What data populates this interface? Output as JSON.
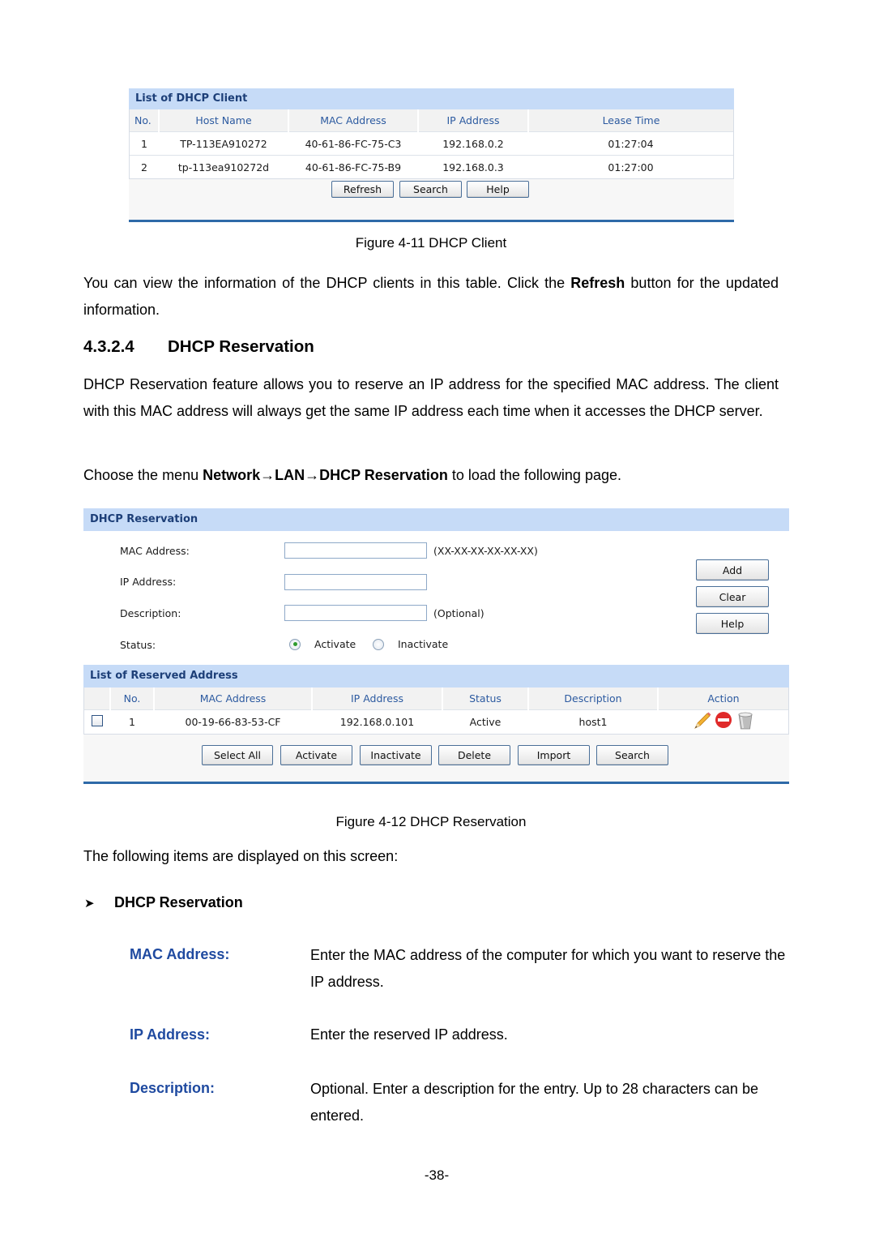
{
  "figure1": {
    "panel_title": "List of DHCP Client",
    "columns": [
      "No.",
      "Host Name",
      "MAC Address",
      "IP Address",
      "Lease Time"
    ],
    "rows": [
      [
        "1",
        "TP-113EA910272",
        "40-61-86-FC-75-C3",
        "192.168.0.2",
        "01:27:04"
      ],
      [
        "2",
        "tp-113ea910272d",
        "40-61-86-FC-75-B9",
        "192.168.0.3",
        "01:27:00"
      ]
    ],
    "buttons": {
      "refresh": "Refresh",
      "search": "Search",
      "help": "Help"
    },
    "caption": "Figure 4-11 DHCP Client"
  },
  "para1": {
    "before": "You can view the information of the DHCP clients in this table. Click the ",
    "bold": "Refresh",
    "after": " button for the updated information."
  },
  "section": {
    "number": "4.3.2.4",
    "title": "DHCP Reservation"
  },
  "para2": "DHCP Reservation feature allows you to reserve an IP address for the specified MAC address. The client with this MAC address will always get the same IP address each time when it accesses the DHCP server.",
  "para3": {
    "before": "Choose the menu ",
    "bold": "Network→LAN→DHCP Reservation",
    "after": " to load the following page."
  },
  "figure2": {
    "form_title": "DHCP Reservation",
    "form": {
      "mac_label": "MAC Address:",
      "mac_value": "",
      "mac_hint": "(XX-XX-XX-XX-XX-XX)",
      "ip_label": "IP Address:",
      "ip_value": "",
      "desc_label": "Description:",
      "desc_value": "",
      "desc_hint": "(Optional)",
      "status_label": "Status:",
      "status_options": [
        "Activate",
        "Inactivate"
      ],
      "status_selected": "Activate"
    },
    "side_buttons": {
      "add": "Add",
      "clear": "Clear",
      "help": "Help"
    },
    "list_title": "List of Reserved Address",
    "columns": [
      "",
      "No.",
      "MAC Address",
      "IP Address",
      "Status",
      "Description",
      "Action"
    ],
    "rows": [
      {
        "checked": false,
        "no": "1",
        "mac": "00-19-66-83-53-CF",
        "ip": "192.168.0.101",
        "status": "Active",
        "description": "host1",
        "actions": [
          "edit-pencil-icon",
          "disable-icon",
          "delete-trash-icon"
        ]
      }
    ],
    "buttons": {
      "select_all": "Select All",
      "activate": "Activate",
      "inactivate": "Inactivate",
      "delete": "Delete",
      "import": "Import",
      "search": "Search"
    },
    "caption": "Figure 4-12 DHCP Reservation"
  },
  "para4": "The following items are displayed on this screen:",
  "bullet": {
    "icon": "arrow-bullet-icon",
    "label": "DHCP Reservation"
  },
  "definitions": [
    {
      "term": "MAC Address:",
      "desc": "Enter the MAC address of the computer for which you want to reserve the IP address."
    },
    {
      "term": "IP Address:",
      "desc": "Enter the reserved IP address."
    },
    {
      "term": "Description:",
      "desc": "Optional. Enter a description for the entry. Up to 28 characters can be entered."
    }
  ],
  "page_number": "-38-",
  "colors": {
    "panel_header": "#c6dbf7",
    "header_text": "#1d3f78",
    "column_header_text": "#2c5aa0",
    "rule": "#2e6aa8",
    "term": "#1f4aa0"
  }
}
